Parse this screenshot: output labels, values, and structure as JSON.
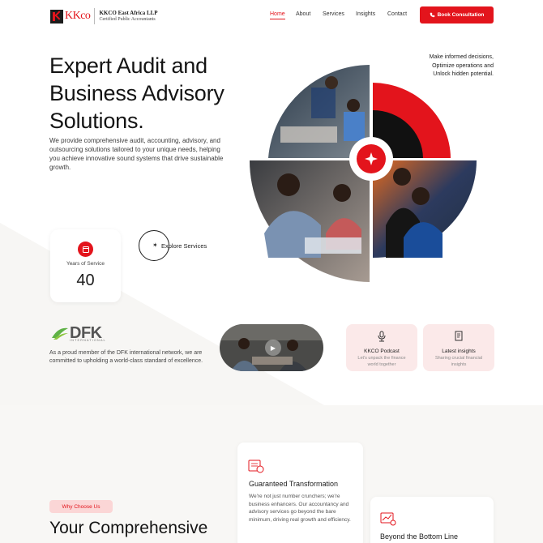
{
  "brand": {
    "logo_mark": "KKco",
    "company_name": "KKCO East Africa LLP",
    "company_sub": "Certified Public Accountants"
  },
  "nav": {
    "items": [
      {
        "label": "Home",
        "active": true
      },
      {
        "label": "Services",
        "active": false
      },
      {
        "label": "About",
        "active": false
      },
      {
        "label": "Insights",
        "active": false
      },
      {
        "label": "Contact",
        "active": false
      }
    ],
    "cta_label": "Book Consultation"
  },
  "hero": {
    "title": "Expert Audit and Business Advisory Solutions.",
    "description": "We provide comprehensive audit, accounting, advisory, and outsourcing solutions tailored to your unique needs, helping you achieve innovative sound systems that drive sustainable growth.",
    "tagline_lines": [
      "Make informed decisions,",
      "Optimize operations and",
      "Unlock hidden potential."
    ]
  },
  "stats": {
    "label": "Years of Service",
    "value": "40"
  },
  "explore": {
    "label": "Explore Services"
  },
  "dfk": {
    "logo_text": "DFK",
    "logo_sub": "INTERNATIONAL",
    "description": "As a proud member of the DFK international network, we are committed to upholding a world-class standard of excellence."
  },
  "cards": [
    {
      "title": "KKCO Podcast",
      "subtitle": "Let's unpack the finance world together",
      "icon": "microphone-icon"
    },
    {
      "title": "Latest insights",
      "subtitle": "Sharing crucial financial insights",
      "icon": "document-icon"
    }
  ],
  "features": [
    {
      "title": "Guaranteed Transformation",
      "description": "We're not just number crunchers; we're business enhancers. Our accountancy and advisory services go beyond the bare minimum, driving real growth and efficiency.",
      "icon": "transformation-icon"
    },
    {
      "title": "Beyond the Bottom Line",
      "description": "",
      "icon": "chart-icon"
    }
  ],
  "why": {
    "badge": "Why Choose Us",
    "title": "Your Comprehensive"
  },
  "colors": {
    "accent": "#e3141c",
    "badge_bg": "#fbd6d6",
    "card_pink": "#fbe9e9"
  }
}
